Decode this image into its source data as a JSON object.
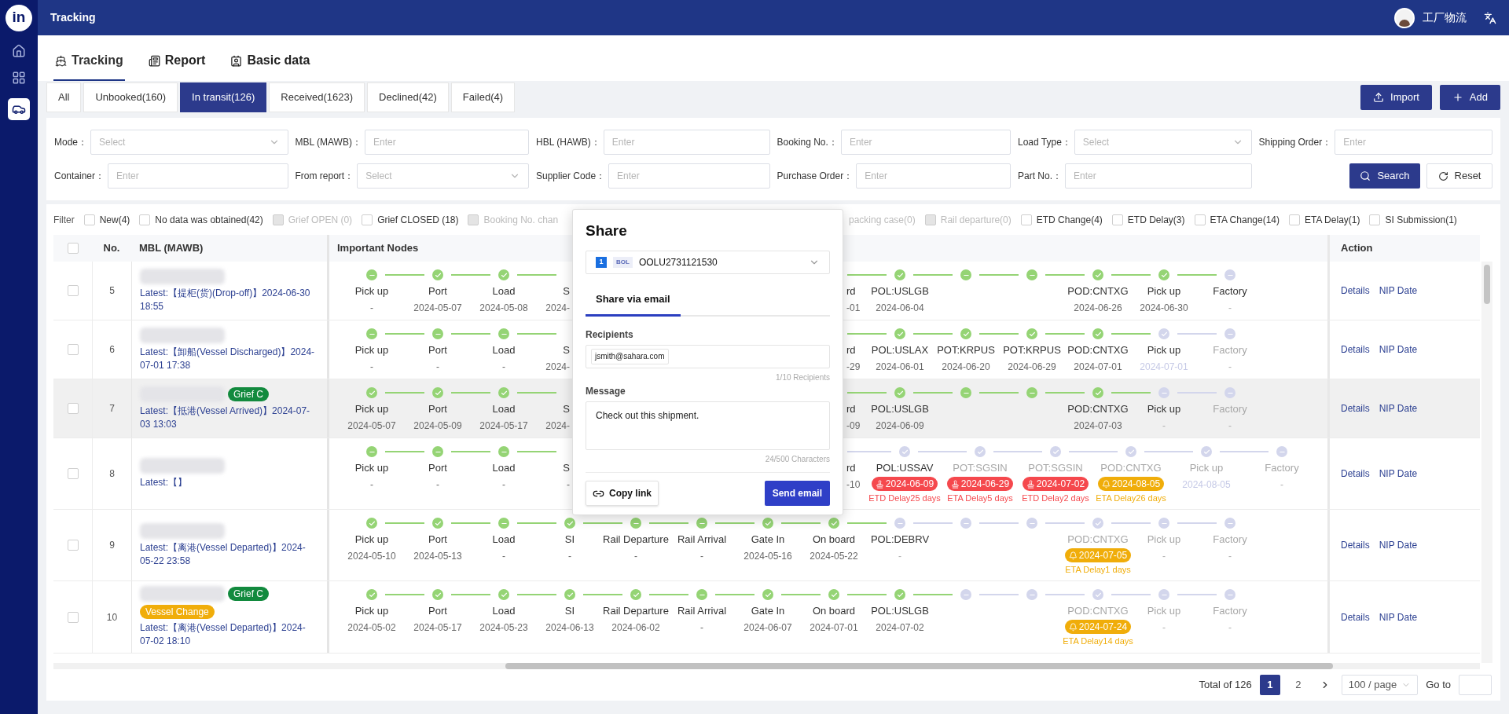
{
  "sidebar": {
    "logo": "in",
    "items": [
      {
        "kind": "home",
        "selected": false
      },
      {
        "kind": "grid",
        "selected": false
      },
      {
        "kind": "car",
        "selected": true
      }
    ]
  },
  "header": {
    "title": "Tracking",
    "user": "工厂物流"
  },
  "nav_tabs": [
    {
      "label": "Tracking",
      "kind": "ship",
      "selected": true
    },
    {
      "label": "Report",
      "kind": "report",
      "selected": false
    },
    {
      "label": "Basic data",
      "kind": "card",
      "selected": false
    }
  ],
  "status_tabs": [
    {
      "label": "All",
      "selected": false
    },
    {
      "label": "Unbooked(160)",
      "selected": false
    },
    {
      "label": "In transit(126)",
      "selected": true
    },
    {
      "label": "Received(1623)",
      "selected": false
    },
    {
      "label": "Declined(42)",
      "selected": false
    },
    {
      "label": "Failed(4)",
      "selected": false
    }
  ],
  "actions": [
    {
      "label": "Import",
      "kind": "upload"
    },
    {
      "label": "Add",
      "kind": "plus"
    }
  ],
  "search_form": {
    "fields": [
      {
        "label": "Mode：",
        "kind": "select",
        "placeholder": "Select"
      },
      {
        "label": "MBL (MAWB)：",
        "kind": "input",
        "placeholder": "Enter"
      },
      {
        "label": "HBL (HAWB)：",
        "kind": "input",
        "placeholder": "Enter"
      },
      {
        "label": "Booking No.：",
        "kind": "input",
        "placeholder": "Enter"
      },
      {
        "label": "Load Type：",
        "kind": "select",
        "placeholder": "Select"
      },
      {
        "label": "Shipping Order：",
        "kind": "input",
        "placeholder": "Enter"
      },
      {
        "label": "Container：",
        "kind": "input",
        "placeholder": "Enter"
      },
      {
        "label": "From report：",
        "kind": "select",
        "placeholder": "Select"
      },
      {
        "label": "Supplier Code：",
        "kind": "input",
        "placeholder": "Enter"
      },
      {
        "label": "Purchase Order：",
        "kind": "input",
        "placeholder": "Enter"
      },
      {
        "label": "Part No.：",
        "kind": "input",
        "placeholder": "Enter"
      }
    ],
    "search_button": "Search",
    "reset_button": "Reset"
  },
  "filter_label": "Filter",
  "filters": [
    {
      "label": "New(4)",
      "checked": false,
      "disabled": false
    },
    {
      "label": "No data was obtained(42)",
      "checked": false,
      "disabled": false
    },
    {
      "label": "Grief OPEN (0)",
      "checked": false,
      "disabled": true
    },
    {
      "label": "Grief CLOSED (18)",
      "checked": false,
      "disabled": false
    },
    {
      "label": "Booking No. chan",
      "checked": false,
      "disabled": true
    }
  ],
  "cut_filter": {
    "label": "packing case(0)",
    "disabled": true
  },
  "filters_right": [
    {
      "label": "Rail departure(0)",
      "checked": false,
      "disabled": true
    },
    {
      "label": "ETD Change(4)",
      "checked": false,
      "disabled": false
    },
    {
      "label": "ETD Delay(3)",
      "checked": false,
      "disabled": false
    },
    {
      "label": "ETA Change(14)",
      "checked": false,
      "disabled": false
    },
    {
      "label": "ETA Delay(1)",
      "checked": false,
      "disabled": false
    },
    {
      "label": "SI Submission(1)",
      "checked": false,
      "disabled": false
    }
  ],
  "table": {
    "columns": [
      "No.",
      "MBL (MAWB)",
      "Important Nodes",
      "Action"
    ],
    "all_selected": false,
    "rows": [
      {
        "no": "5",
        "selected": false,
        "hovered": false,
        "latest": "Latest:【提柜(货)(Drop-off)】2024-06-30 18:55",
        "actions": [
          "Details",
          "NIP Date"
        ],
        "nodes": [
          {
            "kind": "step",
            "reached": true,
            "ticked": false,
            "label": "Pick up",
            "date": "-",
            "muted": false
          },
          {
            "kind": "step",
            "reached": true,
            "ticked": true,
            "label": "Port",
            "date": "2024-05-07",
            "muted": false
          },
          {
            "kind": "step",
            "reached": true,
            "ticked": true,
            "label": "Load",
            "date": "2024-05-08",
            "muted": false
          },
          {
            "kind": "head",
            "label": "S",
            "date": "2024-"
          },
          {
            "kind": "gap"
          },
          {
            "kind": "gap"
          },
          {
            "kind": "gap"
          },
          {
            "kind": "tail",
            "reached": true,
            "label": "rd",
            "date": "-01"
          },
          {
            "kind": "step",
            "reached": true,
            "ticked": true,
            "label": "POL:USLGB",
            "date": "2024-06-04",
            "muted": false
          },
          {
            "kind": "step",
            "reached": true,
            "ticked": false
          },
          {
            "kind": "step",
            "reached": true,
            "ticked": false
          },
          {
            "kind": "step",
            "reached": true,
            "ticked": true,
            "label": "POD:CNTXG",
            "date": "2024-06-26",
            "muted": false
          },
          {
            "kind": "step",
            "reached": true,
            "ticked": true,
            "label": "Pick up",
            "date": "2024-06-30",
            "muted": false
          },
          {
            "kind": "step",
            "reached": false,
            "ticked": false,
            "label": "Factory",
            "date": "-",
            "muted": false
          }
        ]
      },
      {
        "no": "6",
        "selected": false,
        "hovered": false,
        "latest": "Latest:【卸船(Vessel Discharged)】2024-07-01 17:38",
        "actions": [
          "Details",
          "NIP Date"
        ],
        "nodes": [
          {
            "kind": "step",
            "reached": true,
            "ticked": false,
            "label": "Pick up",
            "date": "-",
            "muted": false
          },
          {
            "kind": "step",
            "reached": true,
            "ticked": false,
            "label": "Port",
            "date": "-",
            "muted": false
          },
          {
            "kind": "step",
            "reached": true,
            "ticked": false,
            "label": "Load",
            "date": "-",
            "muted": false
          },
          {
            "kind": "head",
            "label": "S",
            "date": "2024-"
          },
          {
            "kind": "gap"
          },
          {
            "kind": "gap"
          },
          {
            "kind": "gap"
          },
          {
            "kind": "tail",
            "reached": true,
            "label": "rd",
            "date": "-29"
          },
          {
            "kind": "step",
            "reached": true,
            "ticked": true,
            "label": "POL:USLAX",
            "date": "2024-06-01",
            "muted": false
          },
          {
            "kind": "step",
            "reached": true,
            "ticked": true,
            "label": "POT:KRPUS",
            "date": "2024-06-20",
            "muted": false
          },
          {
            "kind": "step",
            "reached": true,
            "ticked": true,
            "label": "POT:KRPUS",
            "date": "2024-06-29",
            "muted": false
          },
          {
            "kind": "step",
            "reached": true,
            "ticked": true,
            "label": "POD:CNTXG",
            "date": "2024-07-01",
            "muted": false
          },
          {
            "kind": "step",
            "reached": false,
            "ticked": true,
            "label": "Pick up",
            "date": "2024-07-01",
            "muted": false
          },
          {
            "kind": "step",
            "reached": false,
            "ticked": false,
            "label": "Factory",
            "date": "-",
            "muted": true
          }
        ]
      },
      {
        "no": "7",
        "selected": false,
        "hovered": true,
        "tags": [
          {
            "label": "Grief C",
            "color": "#128a3e"
          }
        ],
        "latest": "Latest:【抵港(Vessel Arrived)】2024-07-03 13:03",
        "actions": [
          "Details",
          "NIP Date"
        ],
        "nodes": [
          {
            "kind": "step",
            "reached": true,
            "ticked": true,
            "label": "Pick up",
            "date": "2024-05-07",
            "muted": false
          },
          {
            "kind": "step",
            "reached": true,
            "ticked": true,
            "label": "Port",
            "date": "2024-05-09",
            "muted": false
          },
          {
            "kind": "step",
            "reached": true,
            "ticked": true,
            "label": "Load",
            "date": "2024-05-17",
            "muted": false
          },
          {
            "kind": "head",
            "label": "S",
            "date": "2024-"
          },
          {
            "kind": "gap"
          },
          {
            "kind": "gap"
          },
          {
            "kind": "gap"
          },
          {
            "kind": "tail",
            "reached": true,
            "label": "rd",
            "date": "-09"
          },
          {
            "kind": "step",
            "reached": true,
            "ticked": true,
            "label": "POL:USLGB",
            "date": "2024-06-09",
            "muted": false
          },
          {
            "kind": "step",
            "reached": true,
            "ticked": false
          },
          {
            "kind": "step",
            "reached": true,
            "ticked": false
          },
          {
            "kind": "step",
            "reached": true,
            "ticked": true,
            "label": "POD:CNTXG",
            "date": "2024-07-03",
            "muted": false
          },
          {
            "kind": "step",
            "reached": false,
            "ticked": false,
            "label": "Pick up",
            "date": "-",
            "muted": false
          },
          {
            "kind": "step",
            "reached": false,
            "ticked": false,
            "label": "Factory",
            "date": "-",
            "muted": true
          }
        ]
      },
      {
        "no": "8",
        "selected": false,
        "hovered": false,
        "latest": "Latest:【】",
        "actions": [
          "Details",
          "NIP Date"
        ],
        "nodes": [
          {
            "kind": "step",
            "reached": true,
            "ticked": false,
            "label": "Pick up",
            "date": "-",
            "muted": false
          },
          {
            "kind": "step",
            "reached": true,
            "ticked": false,
            "label": "Port",
            "date": "-",
            "muted": false
          },
          {
            "kind": "step",
            "reached": true,
            "ticked": false,
            "label": "Load",
            "date": "-",
            "muted": false
          },
          {
            "kind": "head",
            "label": "S",
            "date": "-"
          },
          {
            "kind": "gap"
          },
          {
            "kind": "gap"
          },
          {
            "kind": "gap"
          },
          {
            "kind": "tail",
            "reached": false,
            "label": "rd",
            "date": "-10"
          },
          {
            "kind": "step",
            "reached": false,
            "ticked": true,
            "label": "POL:USSAV",
            "muted": false,
            "alert": {
              "kind": "stamp",
              "color": "#f5484d",
              "text": "2024-06-09",
              "note": "ETD Delay25 days"
            }
          },
          {
            "kind": "step",
            "reached": false,
            "ticked": true,
            "label": "POT:SGSIN",
            "muted": true,
            "alert": {
              "kind": "stamp",
              "color": "#f5484d",
              "text": "2024-06-29",
              "note": "ETA Delay5 days"
            }
          },
          {
            "kind": "step",
            "reached": false,
            "ticked": true,
            "label": "POT:SGSIN",
            "muted": true,
            "alert": {
              "kind": "stamp",
              "color": "#f5484d",
              "text": "2024-07-02",
              "note": "ETD Delay2 days"
            }
          },
          {
            "kind": "step",
            "reached": false,
            "ticked": true,
            "label": "POD:CNTXG",
            "muted": true,
            "alert": {
              "kind": "bell",
              "color": "#f0ad0a",
              "text": "2024-08-05",
              "note": "ETA Delay26 days"
            }
          },
          {
            "kind": "step",
            "reached": false,
            "ticked": true,
            "label": "Pick up",
            "date": "2024-08-05",
            "muted": true
          },
          {
            "kind": "step",
            "reached": false,
            "ticked": false,
            "label": "Factory",
            "date": "-",
            "muted": true
          }
        ]
      },
      {
        "no": "9",
        "selected": false,
        "hovered": false,
        "latest": "Latest:【离港(Vessel Departed)】2024-05-22 23:58",
        "actions": [
          "Details",
          "NIP Date"
        ],
        "nodes": [
          {
            "kind": "step",
            "reached": true,
            "ticked": true,
            "label": "Pick up",
            "date": "2024-05-10",
            "muted": false
          },
          {
            "kind": "step",
            "reached": true,
            "ticked": true,
            "label": "Port",
            "date": "2024-05-13",
            "muted": false
          },
          {
            "kind": "step",
            "reached": true,
            "ticked": false,
            "label": "Load",
            "date": "-",
            "muted": false
          },
          {
            "kind": "step",
            "reached": true,
            "ticked": true,
            "label": "SI",
            "date": "-",
            "muted": false
          },
          {
            "kind": "step",
            "reached": true,
            "ticked": false,
            "label": "Rail Departure",
            "date": "-",
            "muted": false
          },
          {
            "kind": "step",
            "reached": true,
            "ticked": false,
            "label": "Rail Arrival",
            "date": "-",
            "muted": false
          },
          {
            "kind": "step",
            "reached": true,
            "ticked": true,
            "label": "Gate In",
            "date": "2024-05-16",
            "muted": false
          },
          {
            "kind": "step",
            "reached": true,
            "ticked": true,
            "label": "On board",
            "date": "2024-05-22",
            "muted": false
          },
          {
            "kind": "step",
            "reached": false,
            "ticked": false,
            "label": "POL:DEBRV",
            "date": "-",
            "muted": false
          },
          {
            "kind": "step",
            "reached": false,
            "ticked": false
          },
          {
            "kind": "step",
            "reached": false,
            "ticked": false
          },
          {
            "kind": "step",
            "reached": false,
            "ticked": true,
            "label": "POD:CNTXG",
            "muted": true,
            "alert": {
              "kind": "bell",
              "color": "#f0ad0a",
              "text": "2024-07-05",
              "note": "ETA Delay1 days"
            }
          },
          {
            "kind": "step",
            "reached": false,
            "ticked": false,
            "label": "Pick up",
            "date": "-",
            "muted": true
          },
          {
            "kind": "step",
            "reached": false,
            "ticked": false,
            "label": "Factory",
            "date": "-",
            "muted": true
          }
        ]
      },
      {
        "no": "10",
        "selected": false,
        "hovered": false,
        "tags": [
          {
            "label": "Grief C",
            "color": "#128a3e"
          },
          {
            "label": "Vessel Change",
            "color": "#f0ad0a"
          }
        ],
        "latest": "Latest:【离港(Vessel Departed)】2024-07-02 18:10",
        "actions": [
          "Details",
          "NIP Date"
        ],
        "nodes": [
          {
            "kind": "step",
            "reached": true,
            "ticked": true,
            "label": "Pick up",
            "date": "2024-05-02",
            "muted": false
          },
          {
            "kind": "step",
            "reached": true,
            "ticked": true,
            "label": "Port",
            "date": "2024-05-17",
            "muted": false
          },
          {
            "kind": "step",
            "reached": true,
            "ticked": true,
            "label": "Load",
            "date": "2024-05-23",
            "muted": false
          },
          {
            "kind": "step",
            "reached": true,
            "ticked": true,
            "label": "SI",
            "date": "2024-06-13",
            "muted": false
          },
          {
            "kind": "step",
            "reached": true,
            "ticked": true,
            "label": "Rail Departure",
            "date": "2024-06-02",
            "muted": false
          },
          {
            "kind": "step",
            "reached": true,
            "ticked": false,
            "label": "Rail Arrival",
            "date": "-",
            "muted": false
          },
          {
            "kind": "step",
            "reached": true,
            "ticked": true,
            "label": "Gate In",
            "date": "2024-06-07",
            "muted": false
          },
          {
            "kind": "step",
            "reached": true,
            "ticked": true,
            "label": "On board",
            "date": "2024-07-01",
            "muted": false
          },
          {
            "kind": "step",
            "reached": true,
            "ticked": true,
            "label": "POL:USLGB",
            "date": "2024-07-02",
            "muted": false
          },
          {
            "kind": "step",
            "reached": false,
            "ticked": false
          },
          {
            "kind": "step",
            "reached": false,
            "ticked": false
          },
          {
            "kind": "step",
            "reached": false,
            "ticked": true,
            "label": "POD:CNTXG",
            "muted": true,
            "alert": {
              "kind": "bell",
              "color": "#f0ad0a",
              "text": "2024-07-24",
              "note": "ETA Delay14 days"
            }
          },
          {
            "kind": "step",
            "reached": false,
            "ticked": false,
            "label": "Pick up",
            "date": "-",
            "muted": true
          },
          {
            "kind": "step",
            "reached": false,
            "ticked": false,
            "label": "Factory",
            "date": "-",
            "muted": true
          }
        ]
      }
    ]
  },
  "pagination": {
    "total": "Total of 126",
    "pages": [
      {
        "label": "1",
        "selected": true
      },
      {
        "label": "2",
        "selected": false
      }
    ],
    "page_size": "100 / page",
    "goto_label": "Go to"
  },
  "share_dialog": {
    "title": "Share",
    "shipment": {
      "index": "1",
      "type": "BOL",
      "number": "OOLU2731121530"
    },
    "tabs": [
      {
        "label": "Share via email",
        "selected": true
      }
    ],
    "recipients_label": "Recipients",
    "recipients": [
      "jsmith@sahara.com"
    ],
    "recipients_count": "1/10 Recipients",
    "message_label": "Message",
    "message": "Check out this shipment.",
    "message_count": "24/500 Characters",
    "copy_button": "Copy link",
    "send_button": "Send email"
  }
}
